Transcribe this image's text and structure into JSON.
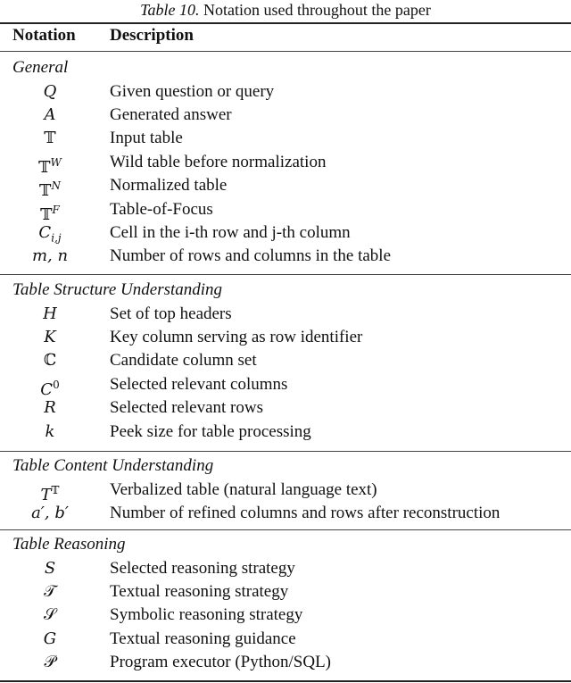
{
  "caption": {
    "label": "Table 10.",
    "text": " Notation used throughout the paper"
  },
  "header": {
    "notation": "Notation",
    "description": "Description"
  },
  "sections": [
    {
      "title": "General",
      "rows": [
        {
          "base": "Q",
          "sup": "",
          "sub": "",
          "upright": false,
          "description": "Given question or query"
        },
        {
          "base": "A",
          "sup": "",
          "sub": "",
          "upright": false,
          "description": "Generated answer"
        },
        {
          "base": "𝕋",
          "sup": "",
          "sub": "",
          "upright": true,
          "description": "Input table"
        },
        {
          "base": "𝕋",
          "sup": "W",
          "sub": "",
          "upright": true,
          "description": "Wild table before normalization"
        },
        {
          "base": "𝕋",
          "sup": "N",
          "sub": "",
          "upright": true,
          "description": "Normalized table"
        },
        {
          "base": "𝕋",
          "sup": "F",
          "sub": "",
          "upright": true,
          "description": "Table-of-Focus"
        },
        {
          "base": "C",
          "sup": "",
          "sub": "i,j",
          "upright": false,
          "description": "Cell in the i-th row and j-th column"
        },
        {
          "base": "m, n",
          "sup": "",
          "sub": "",
          "upright": false,
          "description": "Number of rows and columns in the table"
        }
      ]
    },
    {
      "title": "Table Structure Understanding",
      "rows": [
        {
          "base": "H",
          "sup": "",
          "sub": "",
          "upright": false,
          "description": "Set of top headers"
        },
        {
          "base": "K",
          "sup": "",
          "sub": "",
          "upright": false,
          "description": "Key column serving as row identifier"
        },
        {
          "base": "ℂ",
          "sup": "",
          "sub": "",
          "upright": true,
          "description": "Candidate column set"
        },
        {
          "base": "C",
          "sup": "0",
          "sub": "",
          "upright": false,
          "description": "Selected relevant columns"
        },
        {
          "base": "R",
          "sup": "",
          "sub": "",
          "upright": false,
          "description": "Selected relevant rows"
        },
        {
          "base": "k",
          "sup": "",
          "sub": "",
          "upright": false,
          "description": "Peek size for table processing"
        }
      ]
    },
    {
      "title": "Table Content Understanding",
      "rows": [
        {
          "base": "T",
          "sup": "𝕋",
          "sub": "",
          "upright": false,
          "description": "Verbalized table (natural language text)"
        },
        {
          "base": "a′, b′",
          "sup": "",
          "sub": "",
          "upright": false,
          "description": "Number of refined columns and rows after reconstruction"
        }
      ]
    },
    {
      "title": "Table Reasoning",
      "rows": [
        {
          "base": "S",
          "sup": "",
          "sub": "",
          "upright": false,
          "description": "Selected reasoning strategy"
        },
        {
          "base": "𝒯",
          "sup": "",
          "sub": "",
          "upright": true,
          "description": "Textual reasoning strategy"
        },
        {
          "base": "𝒮",
          "sup": "",
          "sub": "",
          "upright": true,
          "description": "Symbolic reasoning strategy"
        },
        {
          "base": "G",
          "sup": "",
          "sub": "",
          "upright": false,
          "description": "Textual reasoning guidance"
        },
        {
          "base": "𝒫",
          "sup": "",
          "sub": "",
          "upright": true,
          "description": "Program executor (Python/SQL)"
        }
      ]
    }
  ]
}
